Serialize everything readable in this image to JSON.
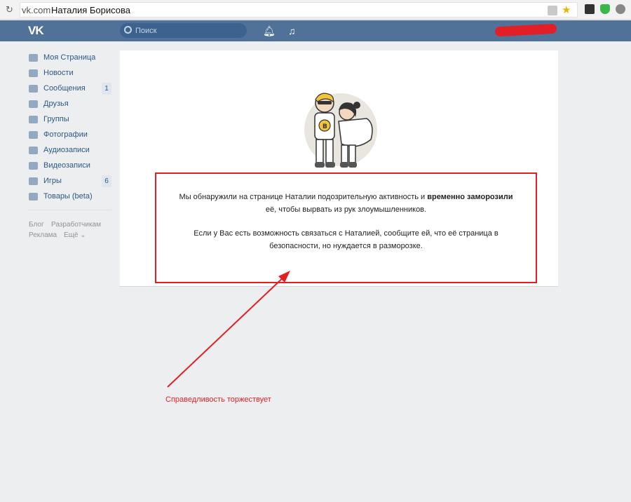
{
  "browser": {
    "url": "vk.com",
    "tab_title": "Наталия Борисова"
  },
  "header": {
    "logo": "VK",
    "search_placeholder": "Поиск"
  },
  "sidebar": {
    "items": [
      {
        "label": "Моя Страница",
        "icon": "home-icon"
      },
      {
        "label": "Новости",
        "icon": "news-icon"
      },
      {
        "label": "Сообщения",
        "icon": "messages-icon",
        "count": "1"
      },
      {
        "label": "Друзья",
        "icon": "friends-icon"
      },
      {
        "label": "Группы",
        "icon": "groups-icon"
      },
      {
        "label": "Фотографии",
        "icon": "camera-icon"
      },
      {
        "label": "Аудиозаписи",
        "icon": "music-icon"
      },
      {
        "label": "Видеозаписи",
        "icon": "video-icon"
      },
      {
        "label": "Игры",
        "icon": "gamepad-icon",
        "count": "6"
      },
      {
        "label": "Товары (beta)",
        "icon": "bag-icon"
      }
    ],
    "footer": {
      "blog": "Блог",
      "developers": "Разработчикам",
      "ads": "Реклама",
      "more": "Ещё ⌄"
    }
  },
  "main": {
    "message": {
      "p1_before": "Мы обнаружили на странице Наталии подозрительную активность и ",
      "p1_bold": "временно заморозили",
      "p1_after": " её, чтобы вырвать из рук злоумышленников.",
      "p2": "Если у Вас есть возможность связаться с Наталией, сообщите ей, что её страница в безопасности, но нуждается в разморозке."
    }
  },
  "annotation": {
    "caption": "Справедливость торжествует",
    "color": "#e21f26"
  },
  "colors": {
    "vk_blue": "#507299",
    "link": "#2a5885",
    "background": "#edeef0"
  }
}
